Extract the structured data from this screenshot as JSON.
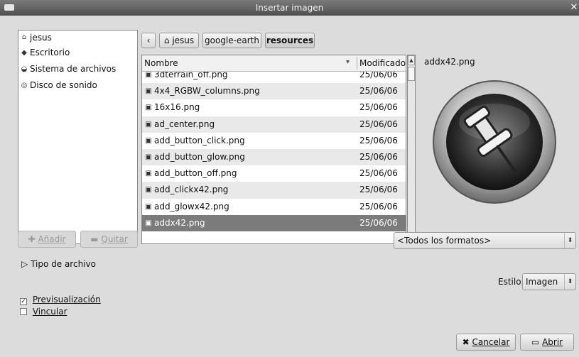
{
  "window": {
    "title": "Insertar imagen",
    "close_glyph": "✕"
  },
  "places": [
    {
      "icon": "home-folder-icon",
      "glyph": "⌂",
      "label": "jesus"
    },
    {
      "icon": "desktop-icon",
      "glyph": "◆",
      "label": "Escritorio"
    },
    {
      "icon": "harddisk-icon",
      "glyph": "◒",
      "label": "Sistema de archivos"
    },
    {
      "icon": "cdrom-icon",
      "glyph": "◎",
      "label": "Disco de sonido"
    }
  ],
  "places_buttons": {
    "add_icon": "✚",
    "add": "Añadir",
    "remove_icon": "▬",
    "remove": "Quitar"
  },
  "path_bar": {
    "back_glyph": "‹",
    "home_glyph": "⌂",
    "crumbs": [
      "jesus",
      "google-earth",
      "resources"
    ]
  },
  "file_list": {
    "col_name": "Nombre",
    "col_modified": "Modificado",
    "sort_glyph": "▾",
    "rows": [
      {
        "name": "3dterrain_off.png",
        "date": "25/06/06"
      },
      {
        "name": "4x4_RGBW_columns.png",
        "date": "25/06/06"
      },
      {
        "name": "16x16.png",
        "date": "25/06/06"
      },
      {
        "name": "ad_center.png",
        "date": "25/06/06"
      },
      {
        "name": "add_button_click.png",
        "date": "25/06/06"
      },
      {
        "name": "add_button_glow.png",
        "date": "25/06/06"
      },
      {
        "name": "add_button_off.png",
        "date": "25/06/06"
      },
      {
        "name": "add_clickx42.png",
        "date": "25/06/06"
      },
      {
        "name": "add_glowx42.png",
        "date": "25/06/06"
      },
      {
        "name": "addx42.png",
        "date": "25/06/06"
      }
    ],
    "selected_index": 9,
    "file_glyph": "▣"
  },
  "scroll": {
    "up": "▲",
    "down": "▼"
  },
  "preview": {
    "filename": "addx42.png"
  },
  "filter": {
    "value": "<Todos los formatos>",
    "arrows": "⬍"
  },
  "file_type_expander": {
    "glyph": "▷",
    "label": "Tipo de archivo"
  },
  "style": {
    "label": "Estilo:",
    "value": "Imagen",
    "arrows": "⬍"
  },
  "options": {
    "preview_label": "Previsualización",
    "preview_checked": true,
    "link_label": "Vincular",
    "link_checked": false
  },
  "actions": {
    "cancel_icon": "✖",
    "cancel": "Cancelar",
    "open_icon": "▭",
    "open": "Abrir"
  }
}
